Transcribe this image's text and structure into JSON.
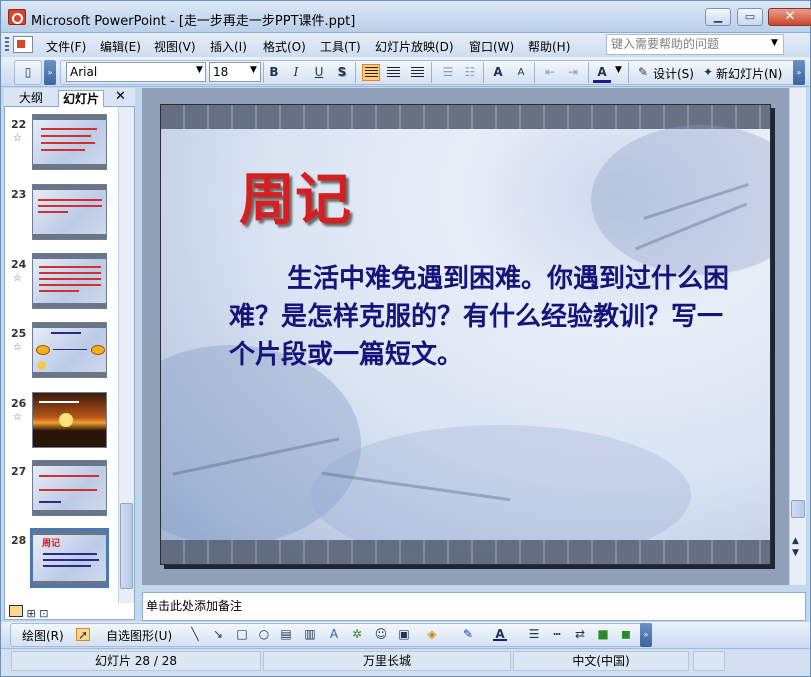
{
  "window": {
    "title": "Microsoft PowerPoint - [走一步再走一步PPT课件.ppt]",
    "minimize": "▁",
    "restore": "▭",
    "close": "✕"
  },
  "menu": {
    "items": [
      "文件(F)",
      "编辑(E)",
      "视图(V)",
      "插入(I)",
      "格式(O)",
      "工具(T)",
      "幻灯片放映(D)",
      "窗口(W)",
      "帮助(H)"
    ],
    "help_placeholder": "键入需要帮助的问题"
  },
  "toolbar": {
    "font": "Arial",
    "size": "18",
    "bold": "B",
    "italic": "I",
    "underline": "U",
    "shadow": "S",
    "grow": "A",
    "shrink": "A",
    "font_color": "A",
    "design": "设计(S)",
    "new_slide": "新幻灯片(N)"
  },
  "panel": {
    "tab_outline": "大纲",
    "tab_slides": "幻灯片",
    "close": "✕"
  },
  "thumbnails": [
    {
      "num": "22",
      "star": "☆",
      "title": "",
      "detail": ""
    },
    {
      "num": "23",
      "star": "",
      "title": "",
      "detail": ""
    },
    {
      "num": "24",
      "star": "☆",
      "title": "",
      "detail": ""
    },
    {
      "num": "25",
      "star": "☆",
      "title": "",
      "detail": ""
    },
    {
      "num": "26",
      "star": "☆",
      "title": "",
      "detail": ""
    },
    {
      "num": "27",
      "star": "",
      "title": "",
      "detail": ""
    },
    {
      "num": "28",
      "star": "",
      "title": "周记",
      "detail": ""
    }
  ],
  "slide": {
    "title": "周记",
    "body": "生活中难免遇到困难。你遇到过什么困难？是怎样克服的？有什么经验教训？写一个片段或一篇短文。"
  },
  "notes": {
    "placeholder": "单击此处添加备注"
  },
  "drawing": {
    "draw": "绘图(R)",
    "autoshapes": "自选图形(U)"
  },
  "status": {
    "slide": "幻灯片 28 / 28",
    "design": "万里长城",
    "language": "中文(中国)"
  }
}
